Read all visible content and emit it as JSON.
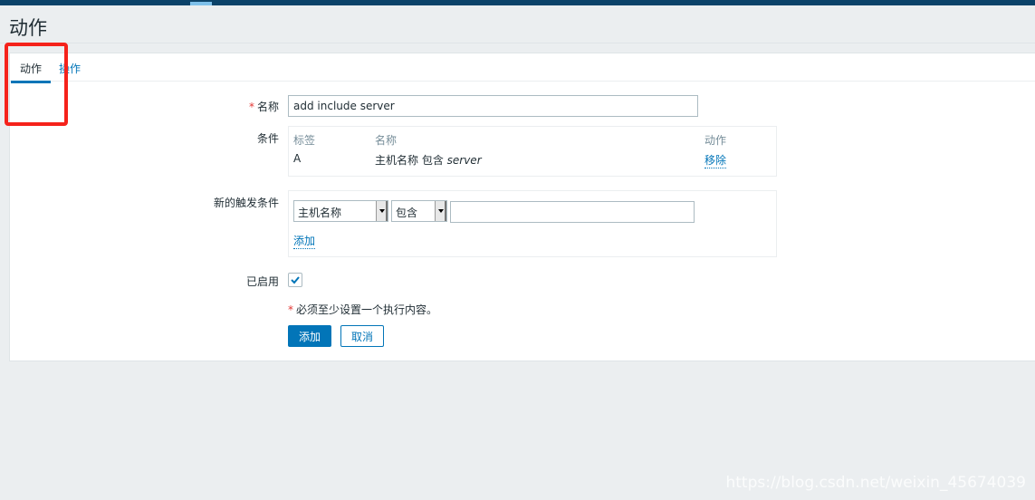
{
  "page": {
    "title": "动作"
  },
  "tabs": [
    {
      "label": "动作",
      "active": true
    },
    {
      "label": "操作",
      "active": false
    }
  ],
  "form": {
    "name_label": "名称",
    "name_value": "add include server",
    "conditions_label": "条件",
    "conditions_table": {
      "headers": [
        "标签",
        "名称",
        "动作"
      ],
      "rows": [
        {
          "label": "A",
          "name_prefix": "主机名称 包含 ",
          "name_value": "server",
          "action": "移除"
        }
      ]
    },
    "new_condition_label": "新的触发条件",
    "new_condition": {
      "type_select": "主机名称",
      "operator_select": "包含",
      "value": "",
      "add_link": "添加"
    },
    "enabled_label": "已启用",
    "enabled": true,
    "required_note": "必须至少设置一个执行内容。",
    "add_button": "添加",
    "cancel_button": "取消"
  },
  "watermark": "https://blog.csdn.net/weixin_45674039",
  "colors": {
    "accent": "#0275b8",
    "topbar": "#0b4269",
    "highlight": "#f5221b"
  }
}
